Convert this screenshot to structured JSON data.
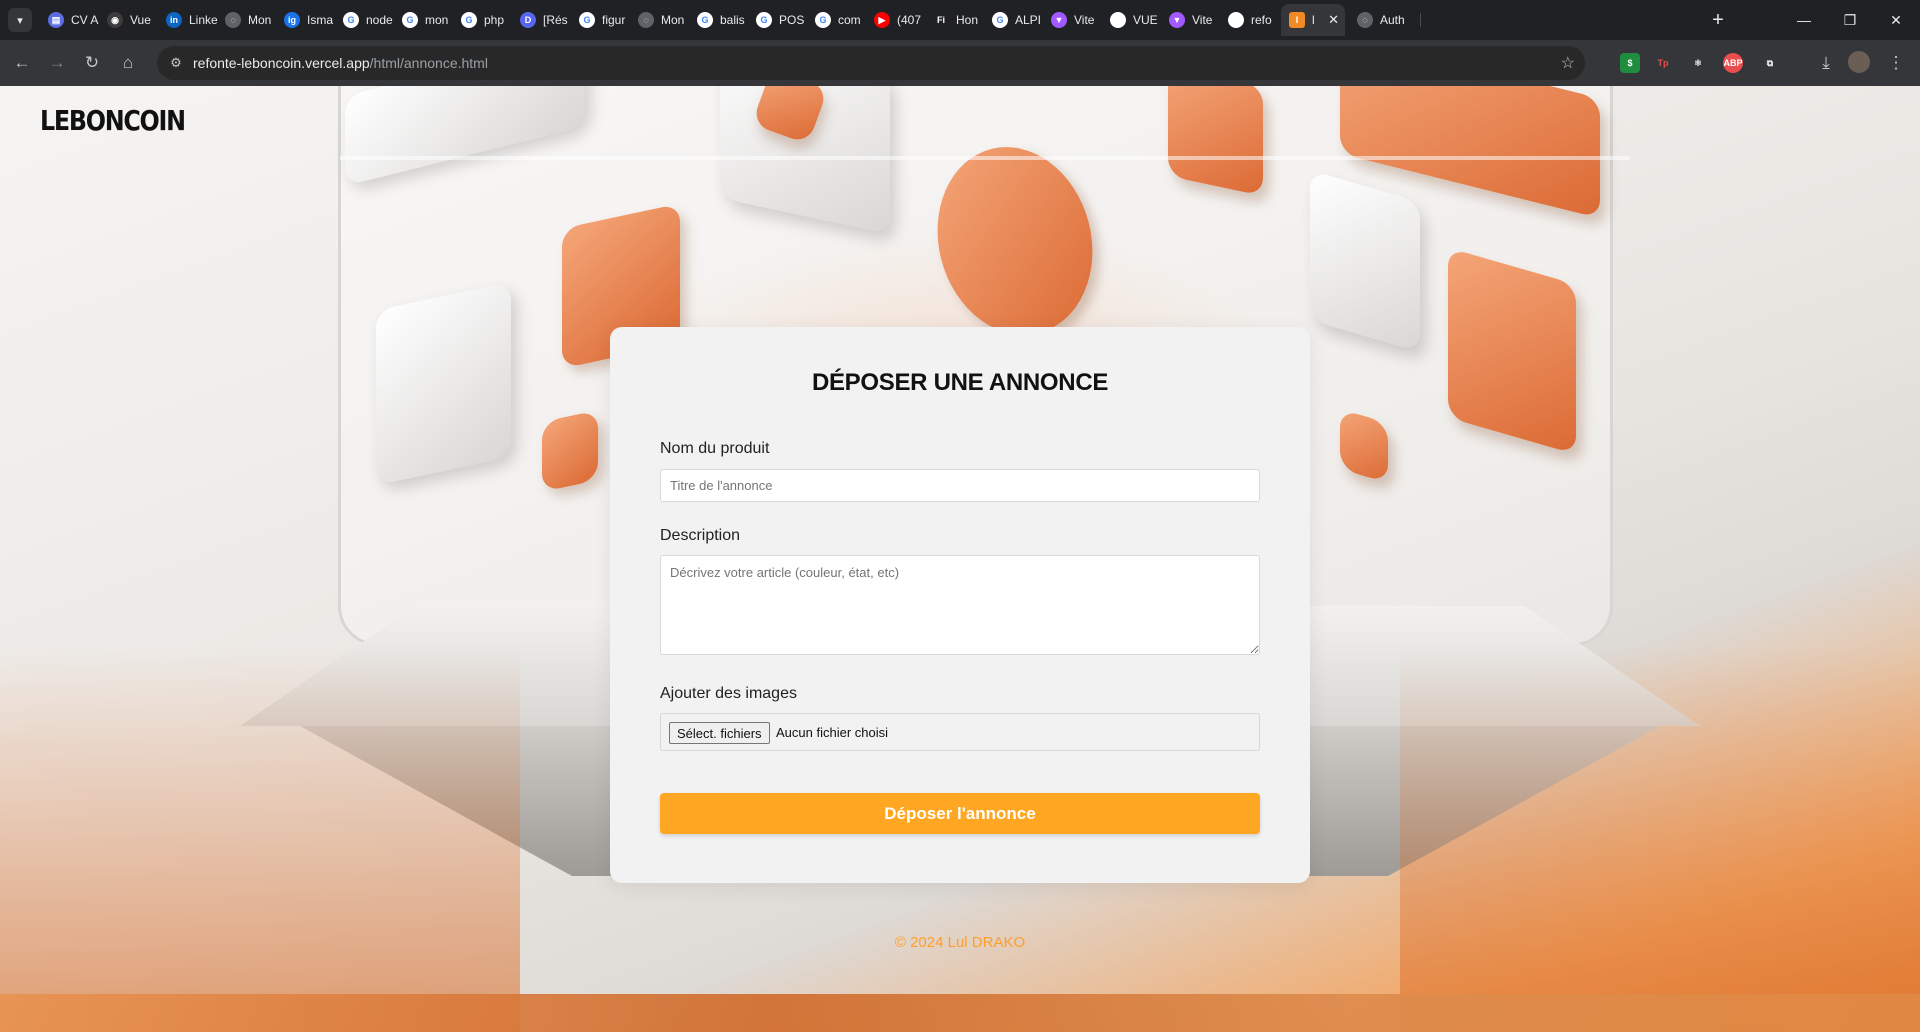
{
  "browser": {
    "tab_menu_icon": "chevron-down",
    "tabs": [
      {
        "label": "CV A",
        "icon_color": "#5b6ee1",
        "icon": "doc"
      },
      {
        "label": "Vue",
        "icon_color": "#3c3c3c",
        "icon": "github"
      },
      {
        "label": "Linke",
        "icon_color": "#0a66c2",
        "icon": "linkedin"
      },
      {
        "label": "Mon",
        "icon_color": "#5f6368",
        "icon": "globe"
      },
      {
        "label": "Isma",
        "icon_color": "#1a73e8",
        "icon": "ig"
      },
      {
        "label": "node",
        "icon_color": "#ffffff",
        "icon": "google"
      },
      {
        "label": "mon",
        "icon_color": "#ffffff",
        "icon": "google"
      },
      {
        "label": "php",
        "icon_color": "#ffffff",
        "icon": "google"
      },
      {
        "label": "[Rés",
        "icon_color": "#5865f2",
        "icon": "discord"
      },
      {
        "label": "figur",
        "icon_color": "#ffffff",
        "icon": "google"
      },
      {
        "label": "Mon",
        "icon_color": "#5f6368",
        "icon": "globe"
      },
      {
        "label": "balis",
        "icon_color": "#ffffff",
        "icon": "google"
      },
      {
        "label": "POS",
        "icon_color": "#ffffff",
        "icon": "google"
      },
      {
        "label": "com",
        "icon_color": "#ffffff",
        "icon": "google"
      },
      {
        "label": "(407",
        "icon_color": "#ff0000",
        "icon": "youtube"
      },
      {
        "label": "Hon",
        "icon_color": "#202124",
        "icon": "fi"
      },
      {
        "label": "ALPI",
        "icon_color": "#ffffff",
        "icon": "google"
      },
      {
        "label": "Vite",
        "icon_color": "#a259ff",
        "icon": "vite"
      },
      {
        "label": "VUE",
        "icon_color": "#ffffff",
        "icon": "doc"
      },
      {
        "label": "Vite",
        "icon_color": "#a259ff",
        "icon": "vite"
      },
      {
        "label": "refo",
        "icon_color": "#ffffff",
        "icon": "vercel"
      }
    ],
    "active_tab": {
      "label": "l",
      "icon_color": "#f08a24",
      "close": "✕"
    },
    "tab_after_active": {
      "label": "Auth",
      "icon_color": "#5f6368",
      "icon": "globe"
    },
    "new_tab": "+",
    "window_controls": {
      "minimize": "—",
      "restore": "❐",
      "close": "✕"
    },
    "nav": {
      "back": "←",
      "forward": "→",
      "reload": "↻",
      "home": "⌂"
    },
    "url_host": "refonte-leboncoin.vercel.app",
    "url_path": "/html/annonce.html",
    "bookmark_icon": "☆",
    "extensions": [
      {
        "name": "extension-green",
        "color": "#1e8e3e",
        "text": "$"
      },
      {
        "name": "extension-tp",
        "color": "#35363a",
        "text": "Tp"
      },
      {
        "name": "extension-react",
        "color": "#35363a",
        "text": "⚛"
      },
      {
        "name": "extension-abp",
        "color": "#e94d4d",
        "text": "ABP"
      },
      {
        "name": "extensions-puzzle",
        "color": "#35363a",
        "text": "⧉"
      }
    ],
    "download_icon": "⤓",
    "menu_icon": "⋮"
  },
  "site": {
    "logo": "LEBONCOIN",
    "form": {
      "title": "DÉPOSER UNE ANNONCE",
      "name_label": "Nom du produit",
      "name_placeholder": "Titre de l'annonce",
      "description_label": "Description",
      "description_placeholder": "Décrivez votre article (couleur, état, etc)",
      "images_label": "Ajouter des images",
      "file_button": "Sélect. fichiers",
      "file_status": "Aucun fichier choisi",
      "submit_label": "Déposer l'annonce"
    },
    "footer": "© 2024 Lul DRAKO",
    "accent_color": "#ffa722"
  }
}
